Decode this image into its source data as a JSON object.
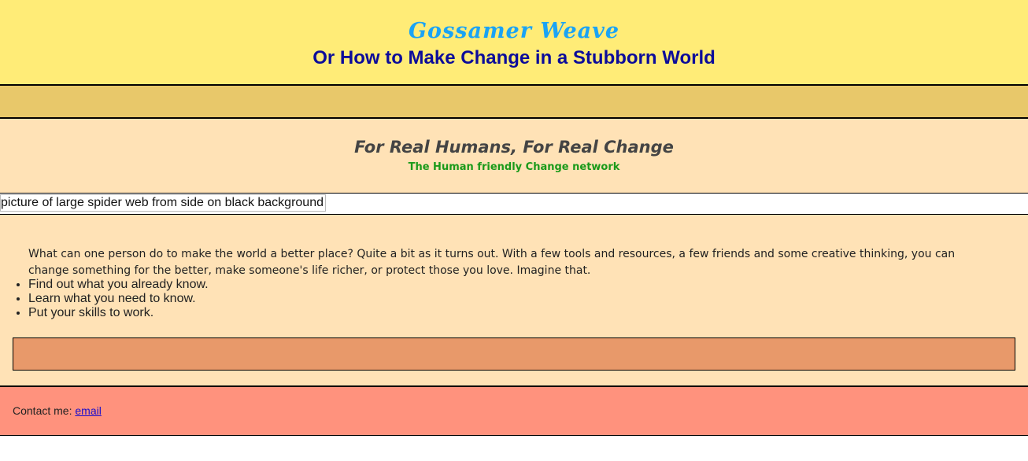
{
  "header": {
    "title": "Gossamer Weave",
    "subtitle": "Or How to Make Change in a Stubborn World"
  },
  "main": {
    "tagline": "For Real Humans, For Real Change",
    "subtagline": "The Human friendly Change network",
    "hero_image_alt": "picture of large spider web from side on black background",
    "intro": "What can one person do to make the world a better place? Quite a bit as it turns out. With a few tools and resources, a few friends and some creative thinking, you can change something for the better, make someone's life richer, or protect those you love. Imagine that.",
    "steps": [
      "Find out what you already know.",
      "Learn what you need to know.",
      "Put your skills to work."
    ]
  },
  "footer": {
    "contact_label": "Contact me: ",
    "email_link": "email"
  },
  "colors": {
    "header_bg": "#ffec77",
    "title": "#1aa3f5",
    "subtitle": "#0c0c9a",
    "nav_bg": "#e8c86a",
    "main_bg": "#ffe2b6",
    "subtag": "#1a9a1a",
    "callout_bg": "#e8996a",
    "footer_bg": "#ff927d",
    "link": "#1a0dcc"
  }
}
